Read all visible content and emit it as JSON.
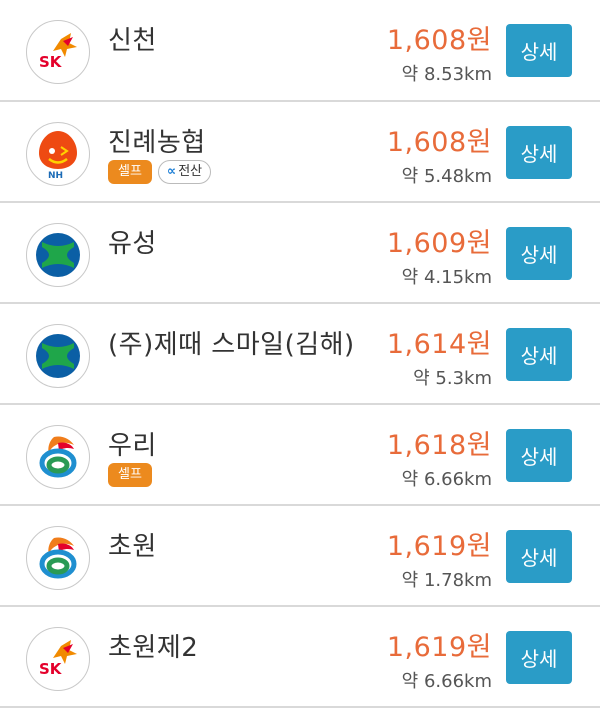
{
  "stations": [
    {
      "brand": "sk-energy",
      "brand_color": "#e4002b",
      "name": "신천",
      "price": "1,608원",
      "distance": "약 8.53km",
      "badges": [],
      "detail_label": "상세"
    },
    {
      "brand": "nh-oil",
      "brand_color": "#ee4a12",
      "name": "진례농협",
      "price": "1,608원",
      "distance": "약 5.48km",
      "badges": [
        "셀프",
        "전산"
      ],
      "detail_label": "상세"
    },
    {
      "brand": "hyundai-oilbank",
      "brand_color": "#0b5fa5",
      "name": "유성",
      "price": "1,609원",
      "distance": "약 4.15km",
      "badges": [],
      "detail_label": "상세"
    },
    {
      "brand": "hyundai-oilbank",
      "brand_color": "#0b5fa5",
      "name": "(주)제때 스마일(김해)",
      "price": "1,614원",
      "distance": "약 5.3km",
      "badges": [],
      "detail_label": "상세"
    },
    {
      "brand": "s-oil-gs",
      "brand_color": "#2a9a55",
      "name": "우리",
      "price": "1,618원",
      "distance": "약 6.66km",
      "badges": [
        "셀프"
      ],
      "detail_label": "상세"
    },
    {
      "brand": "s-oil-gs",
      "brand_color": "#2a9a55",
      "name": "초원",
      "price": "1,619원",
      "distance": "약 1.78km",
      "badges": [],
      "detail_label": "상세"
    },
    {
      "brand": "sk-energy",
      "brand_color": "#e4002b",
      "name": "초원제2",
      "price": "1,619원",
      "distance": "약 6.66km",
      "badges": [],
      "detail_label": "상세"
    }
  ],
  "colors": {
    "price": "#e86b3a",
    "button": "#2a9cc7",
    "self_badge": "#ec8a1e"
  }
}
